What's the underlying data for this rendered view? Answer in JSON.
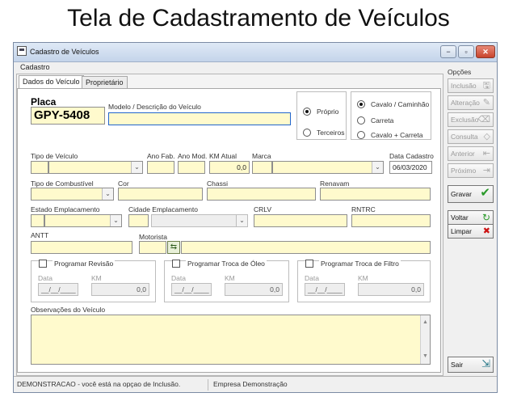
{
  "page_heading": "Tela de Cadastramento de Veículos",
  "window": {
    "title": "Cadastro de Veículos",
    "controls": {
      "minimize": "−",
      "maximize": "▫",
      "close": "✕"
    }
  },
  "menu": {
    "cadastro": "Cadastro"
  },
  "tabs": [
    {
      "label": "Dados do Veículo"
    },
    {
      "label": "Proprietário"
    }
  ],
  "form": {
    "placa": {
      "label": "Placa",
      "value": "GPY-5408"
    },
    "modelo": {
      "label": "Modelo / Descrição do Veículo",
      "value": ""
    },
    "propriedade": {
      "options": [
        "Próprio",
        "Terceiros"
      ],
      "selected": "Próprio"
    },
    "tipo_composicao": {
      "options": [
        "Cavalo / Caminhão",
        "Carreta",
        "Cavalo + Carreta"
      ],
      "selected": "Cavalo / Caminhão"
    },
    "tipo_veiculo": {
      "label": "Tipo de Veículo",
      "code": "",
      "value": ""
    },
    "ano_fab": {
      "label": "Ano Fab.",
      "value": ""
    },
    "ano_mod": {
      "label": "Ano Mod.",
      "value": ""
    },
    "km_atual": {
      "label": "KM Atual",
      "value": "0,0"
    },
    "marca": {
      "label": "Marca",
      "code": "",
      "value": ""
    },
    "data_cadastro": {
      "label": "Data Cadastro",
      "value": "06/03/2020"
    },
    "tipo_combustivel": {
      "label": "Tipo de Combustível",
      "value": ""
    },
    "cor": {
      "label": "Cor",
      "value": ""
    },
    "chassi": {
      "label": "Chassi",
      "value": ""
    },
    "renavam": {
      "label": "Renavam",
      "value": ""
    },
    "estado_emplacamento": {
      "label": "Estado Emplacamento",
      "value": ""
    },
    "cidade_emplacamento": {
      "label": "Cidade Emplacamento",
      "value": ""
    },
    "crlv": {
      "label": "CRLV",
      "value": ""
    },
    "rntrc": {
      "label": "RNTRC",
      "value": ""
    },
    "antt": {
      "label": "ANTT",
      "value": ""
    },
    "motorista": {
      "label": "Motorista",
      "code": "",
      "value": ""
    },
    "revisao": {
      "label": "Programar Revisão",
      "data_label": "Data",
      "data_value": "__/__/____",
      "km_label": "KM",
      "km_value": "0,0"
    },
    "troca_oleo": {
      "label": "Programar Troca de Óleo",
      "data_label": "Data",
      "data_value": "__/__/____",
      "km_label": "KM",
      "km_value": "0,0"
    },
    "troca_filtro": {
      "label": "Programar Troca de Filtro",
      "data_label": "Data",
      "data_value": "__/__/____",
      "km_label": "KM",
      "km_value": "0,0"
    },
    "observacoes": {
      "label": "Observações do Veículo",
      "value": ""
    }
  },
  "sidebar": {
    "title": "Opções",
    "buttons": [
      {
        "label": "Inclusão",
        "icon": "save-icon",
        "glyph": "🖫",
        "enabled": false
      },
      {
        "label": "Alteração",
        "icon": "edit-icon",
        "glyph": "✎",
        "enabled": false
      },
      {
        "label": "Exclusão",
        "icon": "delete-icon",
        "glyph": "⌫",
        "enabled": false
      },
      {
        "label": "Consulta",
        "icon": "search-icon",
        "glyph": "◇",
        "enabled": false
      },
      {
        "label": "Anterior",
        "icon": "previous-icon",
        "glyph": "⇤",
        "enabled": false
      },
      {
        "label": "Próximo",
        "icon": "next-icon",
        "glyph": "⇥",
        "enabled": false
      },
      {
        "label": "Gravar",
        "icon": "check-icon",
        "glyph": "✔",
        "enabled": true
      },
      {
        "label": "Voltar",
        "icon": "refresh-icon",
        "glyph": "↻",
        "enabled": true
      },
      {
        "label": "Limpar",
        "icon": "clear-icon",
        "glyph": "✖",
        "enabled": true
      },
      {
        "label": "Sair",
        "icon": "exit-icon",
        "glyph": "⇲",
        "enabled": true
      }
    ]
  },
  "status": {
    "message": "DEMONSTRACAO - você está na opçao de Inclusão.",
    "company": "Empresa Demonstração"
  },
  "colors": {
    "field_bg": "#fffacd",
    "gravar_icon": "#2a9a2a",
    "voltar_icon": "#2a9a2a",
    "limpar_icon": "#cc1111",
    "close_button": "#c8442c"
  }
}
